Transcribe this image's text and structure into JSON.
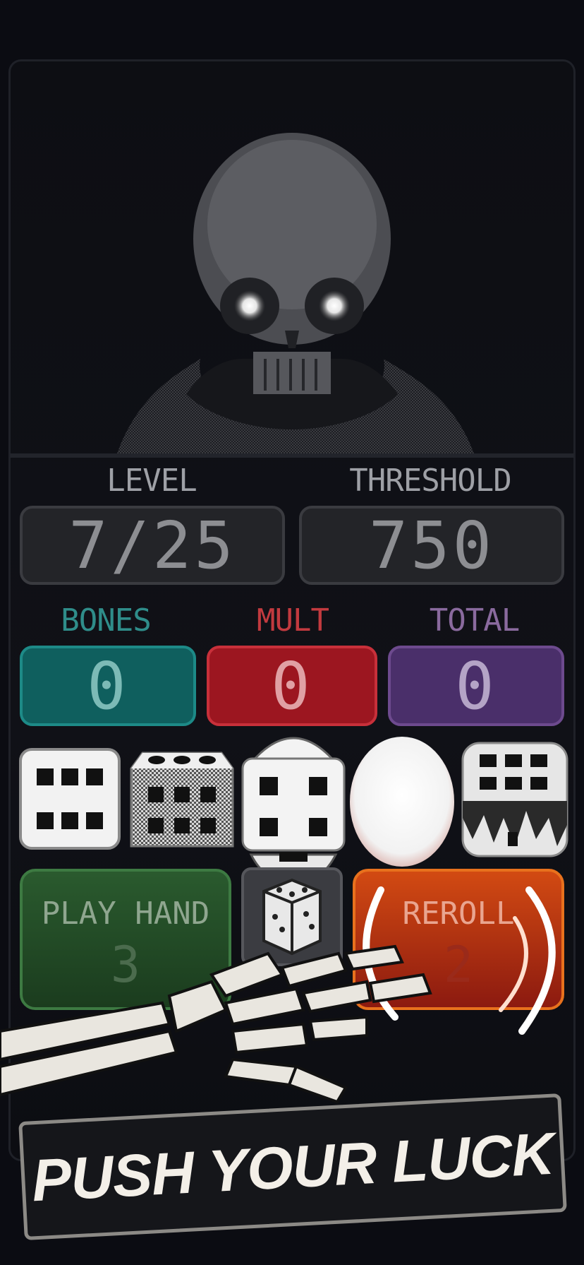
{
  "stats": {
    "level_label": "LEVEL",
    "level_value": "7/25",
    "threshold_label": "THRESHOLD",
    "threshold_value": "750"
  },
  "score": {
    "bones_label": "BONES",
    "bones_value": "0",
    "mult_label": "MULT",
    "mult_value": "0",
    "total_label": "TOTAL",
    "total_value": "0"
  },
  "dice": [
    {
      "face": 6,
      "icon": "die-six-icon"
    },
    {
      "face": 6,
      "icon": "die-six-checkered-icon"
    },
    {
      "face": 4,
      "icon": "die-four-icon"
    },
    {
      "face": 0,
      "icon": "die-glowing-icon"
    },
    {
      "face": 6,
      "icon": "die-six-melting-icon"
    }
  ],
  "actions": {
    "play_label": "PLAY HAND",
    "play_count": "3",
    "reroll_label": "REROLL",
    "reroll_count": "2",
    "center_icon": "dice-box-icon"
  },
  "banner": {
    "text": "PUSH YOUR LUCK"
  },
  "colors": {
    "bones": "#0f5f5e",
    "mult": "#9c1620",
    "total": "#4a2f6a",
    "play": "#2a5a2e",
    "reroll": "#d24a12"
  }
}
